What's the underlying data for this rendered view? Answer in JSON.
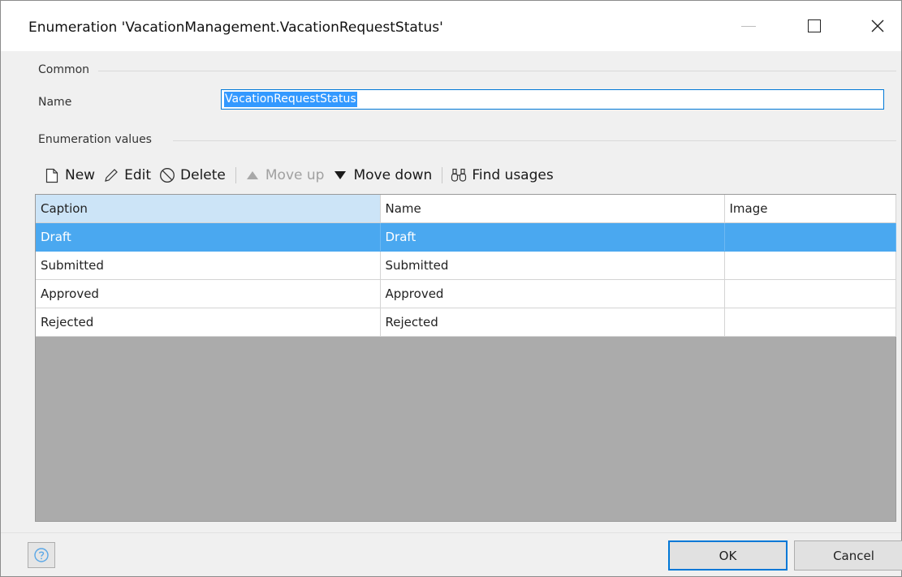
{
  "window": {
    "title": "Enumeration 'VacationManagement.VacationRequestStatus'"
  },
  "common": {
    "group_label": "Common",
    "name_label": "Name",
    "name_value": "VacationRequestStatus"
  },
  "values": {
    "group_label": "Enumeration values",
    "toolbar": {
      "new": "New",
      "edit": "Edit",
      "delete": "Delete",
      "move_up": "Move up",
      "move_down": "Move down",
      "find_usages": "Find usages"
    },
    "columns": [
      "Caption",
      "Name",
      "Image"
    ],
    "rows": [
      {
        "caption": "Draft",
        "name": "Draft",
        "image": ""
      },
      {
        "caption": "Submitted",
        "name": "Submitted",
        "image": ""
      },
      {
        "caption": "Approved",
        "name": "Approved",
        "image": ""
      },
      {
        "caption": "Rejected",
        "name": "Rejected",
        "image": ""
      }
    ]
  },
  "buttons": {
    "ok": "OK",
    "cancel": "Cancel"
  },
  "colors": {
    "accent": "#0078d7",
    "selection": "#4aa8f0",
    "header_active": "#cce4f7",
    "grid_empty": "#ababab"
  }
}
